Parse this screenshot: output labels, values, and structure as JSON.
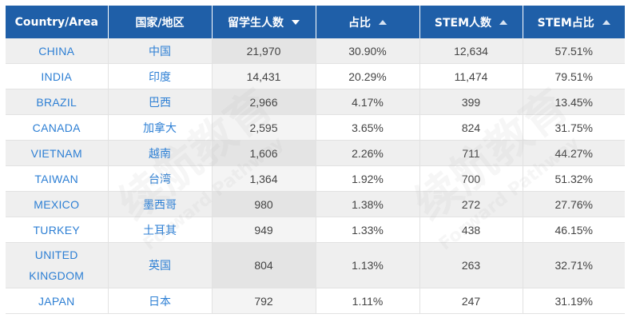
{
  "table": {
    "headers": [
      {
        "label": "Country/Area",
        "sort": "none"
      },
      {
        "label": "国家/地区",
        "sort": "none"
      },
      {
        "label": "留学生人数",
        "sort": "desc"
      },
      {
        "label": "占比",
        "sort": "asc"
      },
      {
        "label": "STEM人数",
        "sort": "asc"
      },
      {
        "label": "STEM占比",
        "sort": "asc"
      }
    ],
    "rows": [
      {
        "country": "CHINA",
        "cn": "中国",
        "students": "21,970",
        "share": "30.90%",
        "stem": "12,634",
        "stem_share": "57.51%"
      },
      {
        "country": "INDIA",
        "cn": "印度",
        "students": "14,431",
        "share": "20.29%",
        "stem": "11,474",
        "stem_share": "79.51%"
      },
      {
        "country": "BRAZIL",
        "cn": "巴西",
        "students": "2,966",
        "share": "4.17%",
        "stem": "399",
        "stem_share": "13.45%"
      },
      {
        "country": "CANADA",
        "cn": "加拿大",
        "students": "2,595",
        "share": "3.65%",
        "stem": "824",
        "stem_share": "31.75%"
      },
      {
        "country": "VIETNAM",
        "cn": "越南",
        "students": "1,606",
        "share": "2.26%",
        "stem": "711",
        "stem_share": "44.27%"
      },
      {
        "country": "TAIWAN",
        "cn": "台湾",
        "students": "1,364",
        "share": "1.92%",
        "stem": "700",
        "stem_share": "51.32%"
      },
      {
        "country": "MEXICO",
        "cn": "墨西哥",
        "students": "980",
        "share": "1.38%",
        "stem": "272",
        "stem_share": "27.76%"
      },
      {
        "country": "TURKEY",
        "cn": "土耳其",
        "students": "949",
        "share": "1.33%",
        "stem": "438",
        "stem_share": "46.15%"
      },
      {
        "country": "UNITED KINGDOM",
        "cn": "英国",
        "students": "804",
        "share": "1.13%",
        "stem": "263",
        "stem_share": "32.71%"
      },
      {
        "country": "JAPAN",
        "cn": "日本",
        "students": "792",
        "share": "1.11%",
        "stem": "247",
        "stem_share": "31.19%"
      }
    ]
  },
  "watermark": {
    "text": "续航教育",
    "sub": "Forward Pathway"
  },
  "colors": {
    "header_bg": "#1f5fa8",
    "link": "#2d7fd4",
    "row_alt": "#efefef"
  }
}
